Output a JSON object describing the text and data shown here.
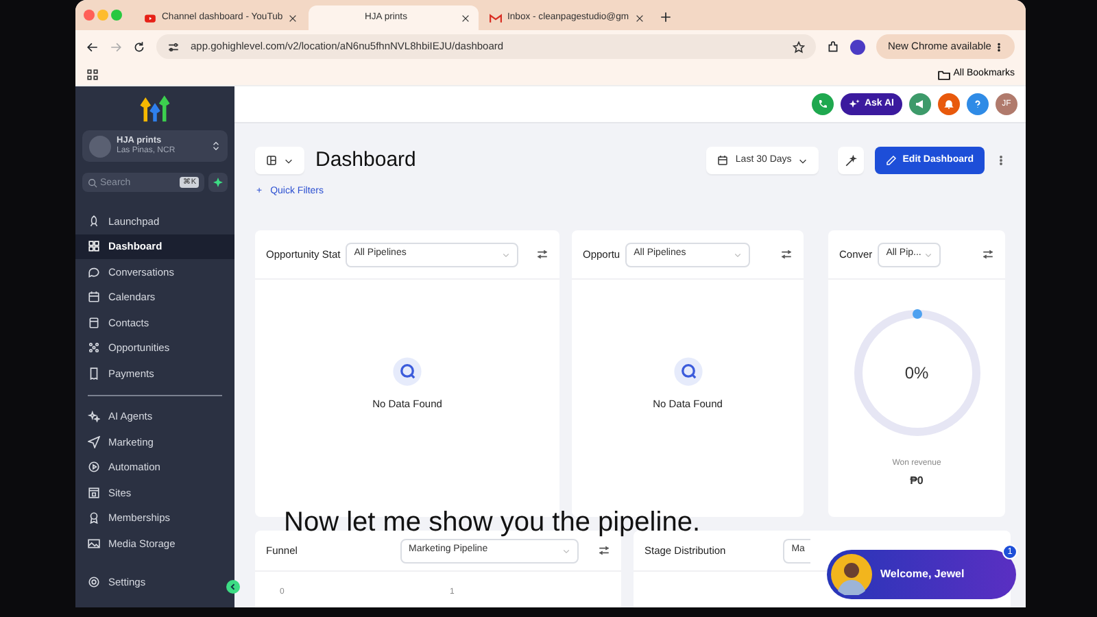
{
  "browser": {
    "tabs": [
      {
        "title": "Channel dashboard - YouTub",
        "selected": false
      },
      {
        "title": "HJA prints",
        "selected": true
      },
      {
        "title": "Inbox - cleanpagestudio@gm",
        "selected": false
      }
    ],
    "url": "app.gohighlevel.com/v2/location/aN6nu5fhnNVL8hbiIEJU/dashboard",
    "update_button": "New Chrome available",
    "bookmarks": "All Bookmarks"
  },
  "sidebar": {
    "account": {
      "name": "HJA prints",
      "location": "Las Pinas, NCR"
    },
    "search": {
      "placeholder": "Search",
      "shortcut": "⌘K"
    },
    "sections": [
      [
        {
          "label": "Launchpad",
          "selected": false
        },
        {
          "label": "Dashboard",
          "selected": true
        },
        {
          "label": "Conversations",
          "selected": false
        },
        {
          "label": "Calendars",
          "selected": false
        },
        {
          "label": "Contacts",
          "selected": false
        },
        {
          "label": "Opportunities",
          "selected": false
        },
        {
          "label": "Payments",
          "selected": false
        }
      ],
      [
        {
          "label": "AI Agents",
          "selected": false
        },
        {
          "label": "Marketing",
          "selected": false
        },
        {
          "label": "Automation",
          "selected": false
        },
        {
          "label": "Sites",
          "selected": false
        },
        {
          "label": "Memberships",
          "selected": false
        },
        {
          "label": "Media Storage",
          "selected": false
        }
      ]
    ],
    "settings": "Settings"
  },
  "header": {
    "ask_ai": "Ask AI",
    "avatar": "JF"
  },
  "toolbar": {
    "title": "Dashboard",
    "date_range": "Last 30 Days",
    "edit": "Edit Dashboard",
    "quick_filters": "Quick Filters",
    "add": "+"
  },
  "widgets": [
    {
      "kind": "empty",
      "title": "Opportunity Stat",
      "select": "All Pipelines",
      "message": "No Data Found"
    },
    {
      "kind": "empty",
      "title": "Opportu",
      "select": "All Pipelines",
      "message": "No Data Found"
    },
    {
      "kind": "gauge",
      "title": "Conver",
      "select": "All Pip...",
      "value": "0%",
      "caption": "Won revenue",
      "amount": "₱0"
    },
    {
      "kind": "axis",
      "title": "Funnel",
      "select": "Marketing Pipeline",
      "ticks": [
        "0",
        "1"
      ]
    },
    {
      "kind": "blank",
      "title": "Stage Distribution",
      "select": "Ma"
    }
  ],
  "caption": "Now let me show you the pipeline.",
  "chat": {
    "text": "Welcome, Jewel",
    "badge": "1"
  }
}
